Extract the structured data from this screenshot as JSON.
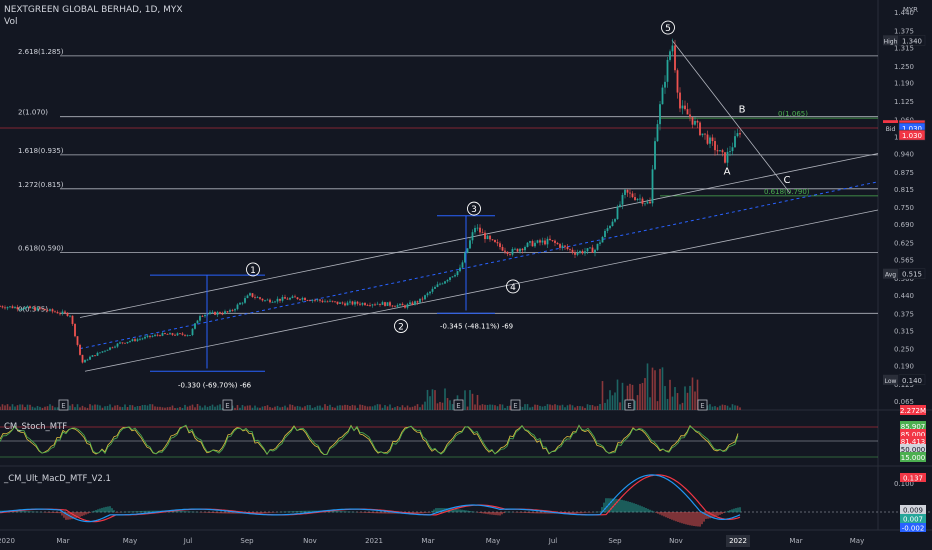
{
  "header": {
    "symbol_line": "NEXTGREEN GLOBAL BERHAD, 1D, MYX",
    "vol_label": "Vol",
    "currency": "MYR"
  },
  "indicators": {
    "stoch_label": "CM_Stoch_MTF",
    "macd_label": "_CM_Ult_MacD_MTF_V2.1"
  },
  "colors": {
    "bg": "#131722",
    "up": "#26a69a",
    "down": "#ef5350",
    "fib": "#b2b5be",
    "blue": "#2962ff",
    "green": "#4caf50",
    "red": "#f23645"
  },
  "chart_data": [
    {
      "type": "candlestick",
      "title": "NEXTGREEN GLOBAL BERHAD, 1D, MYX",
      "x_ticks": [
        "2020",
        "Mar",
        "May",
        "Jul",
        "Sep",
        "Nov",
        "2021",
        "Mar",
        "May",
        "Jul",
        "Sep",
        "Nov",
        "2022",
        "Mar",
        "May"
      ],
      "y_ticks": [
        1.44,
        1.375,
        1.315,
        1.25,
        1.19,
        1.125,
        1.06,
        1.0,
        0.94,
        0.875,
        0.815,
        0.75,
        0.69,
        0.625,
        0.565,
        0.5,
        0.44,
        0.375,
        0.315,
        0.25,
        0.19,
        0.125,
        0.065
      ],
      "ylim": [
        0.05,
        1.45
      ],
      "price_path": [
        [
          0,
          0.4
        ],
        [
          40,
          0.39
        ],
        [
          70,
          0.37
        ],
        [
          82,
          0.2
        ],
        [
          90,
          0.22
        ],
        [
          120,
          0.27
        ],
        [
          160,
          0.3
        ],
        [
          190,
          0.3
        ],
        [
          200,
          0.37
        ],
        [
          230,
          0.38
        ],
        [
          250,
          0.44
        ],
        [
          265,
          0.42
        ],
        [
          300,
          0.43
        ],
        [
          340,
          0.41
        ],
        [
          380,
          0.41
        ],
        [
          405,
          0.4
        ],
        [
          420,
          0.42
        ],
        [
          440,
          0.48
        ],
        [
          460,
          0.53
        ],
        [
          475,
          0.68
        ],
        [
          490,
          0.63
        ],
        [
          510,
          0.59
        ],
        [
          530,
          0.62
        ],
        [
          550,
          0.63
        ],
        [
          575,
          0.59
        ],
        [
          595,
          0.6
        ],
        [
          605,
          0.66
        ],
        [
          615,
          0.72
        ],
        [
          625,
          0.8
        ],
        [
          640,
          0.78
        ],
        [
          650,
          0.76
        ],
        [
          655,
          1.0
        ],
        [
          665,
          1.21
        ],
        [
          672,
          1.34
        ],
        [
          680,
          1.1
        ],
        [
          690,
          1.07
        ],
        [
          700,
          1.02
        ],
        [
          710,
          0.98
        ],
        [
          725,
          0.92
        ],
        [
          740,
          1.02
        ]
      ],
      "fib_levels": [
        {
          "label": "2.618(1.285)",
          "value": 1.285
        },
        {
          "label": "2(1.070)",
          "value": 1.07
        },
        {
          "label": "1.618(0.935)",
          "value": 0.935
        },
        {
          "label": "1.272(0.815)",
          "value": 0.815
        },
        {
          "label": "0.618(0.590)",
          "value": 0.59
        },
        {
          "label": "0(0.375)",
          "value": 0.375
        }
      ],
      "fib2_levels": [
        {
          "label": "0(1.065)",
          "value": 1.065
        },
        {
          "label": "0.618(0.790)",
          "value": 0.79
        }
      ],
      "wave_labels": [
        "1",
        "2",
        "3",
        "4",
        "5"
      ],
      "abc_labels": [
        "A",
        "B",
        "C"
      ],
      "measurements": [
        "-0.330 (-69.70%) -66",
        "-0.345 (-48.11%) -69"
      ],
      "price_tags": [
        {
          "label": "High",
          "value": "1.340"
        },
        {
          "label": "Ask",
          "value": "1.040"
        },
        {
          "label": "Bid",
          "value": "1.030"
        },
        {
          "label": "",
          "value": "1.030"
        },
        {
          "label": "Avg",
          "value": "0.515"
        },
        {
          "label": "Low",
          "value": "0.140"
        }
      ],
      "volume_tag": "2.272M"
    },
    {
      "type": "line",
      "title": "CM_Stoch_MTF",
      "y_tags": [
        "85.907",
        "85.000",
        "81.413",
        "50.000",
        "15.000"
      ]
    },
    {
      "type": "line",
      "title": "_CM_Ult_MacD_MTF_V2.1",
      "y_ticks": [
        "0.100"
      ],
      "y_tags": [
        "0.137",
        "0.009",
        "0.007",
        "-0.002"
      ]
    }
  ]
}
